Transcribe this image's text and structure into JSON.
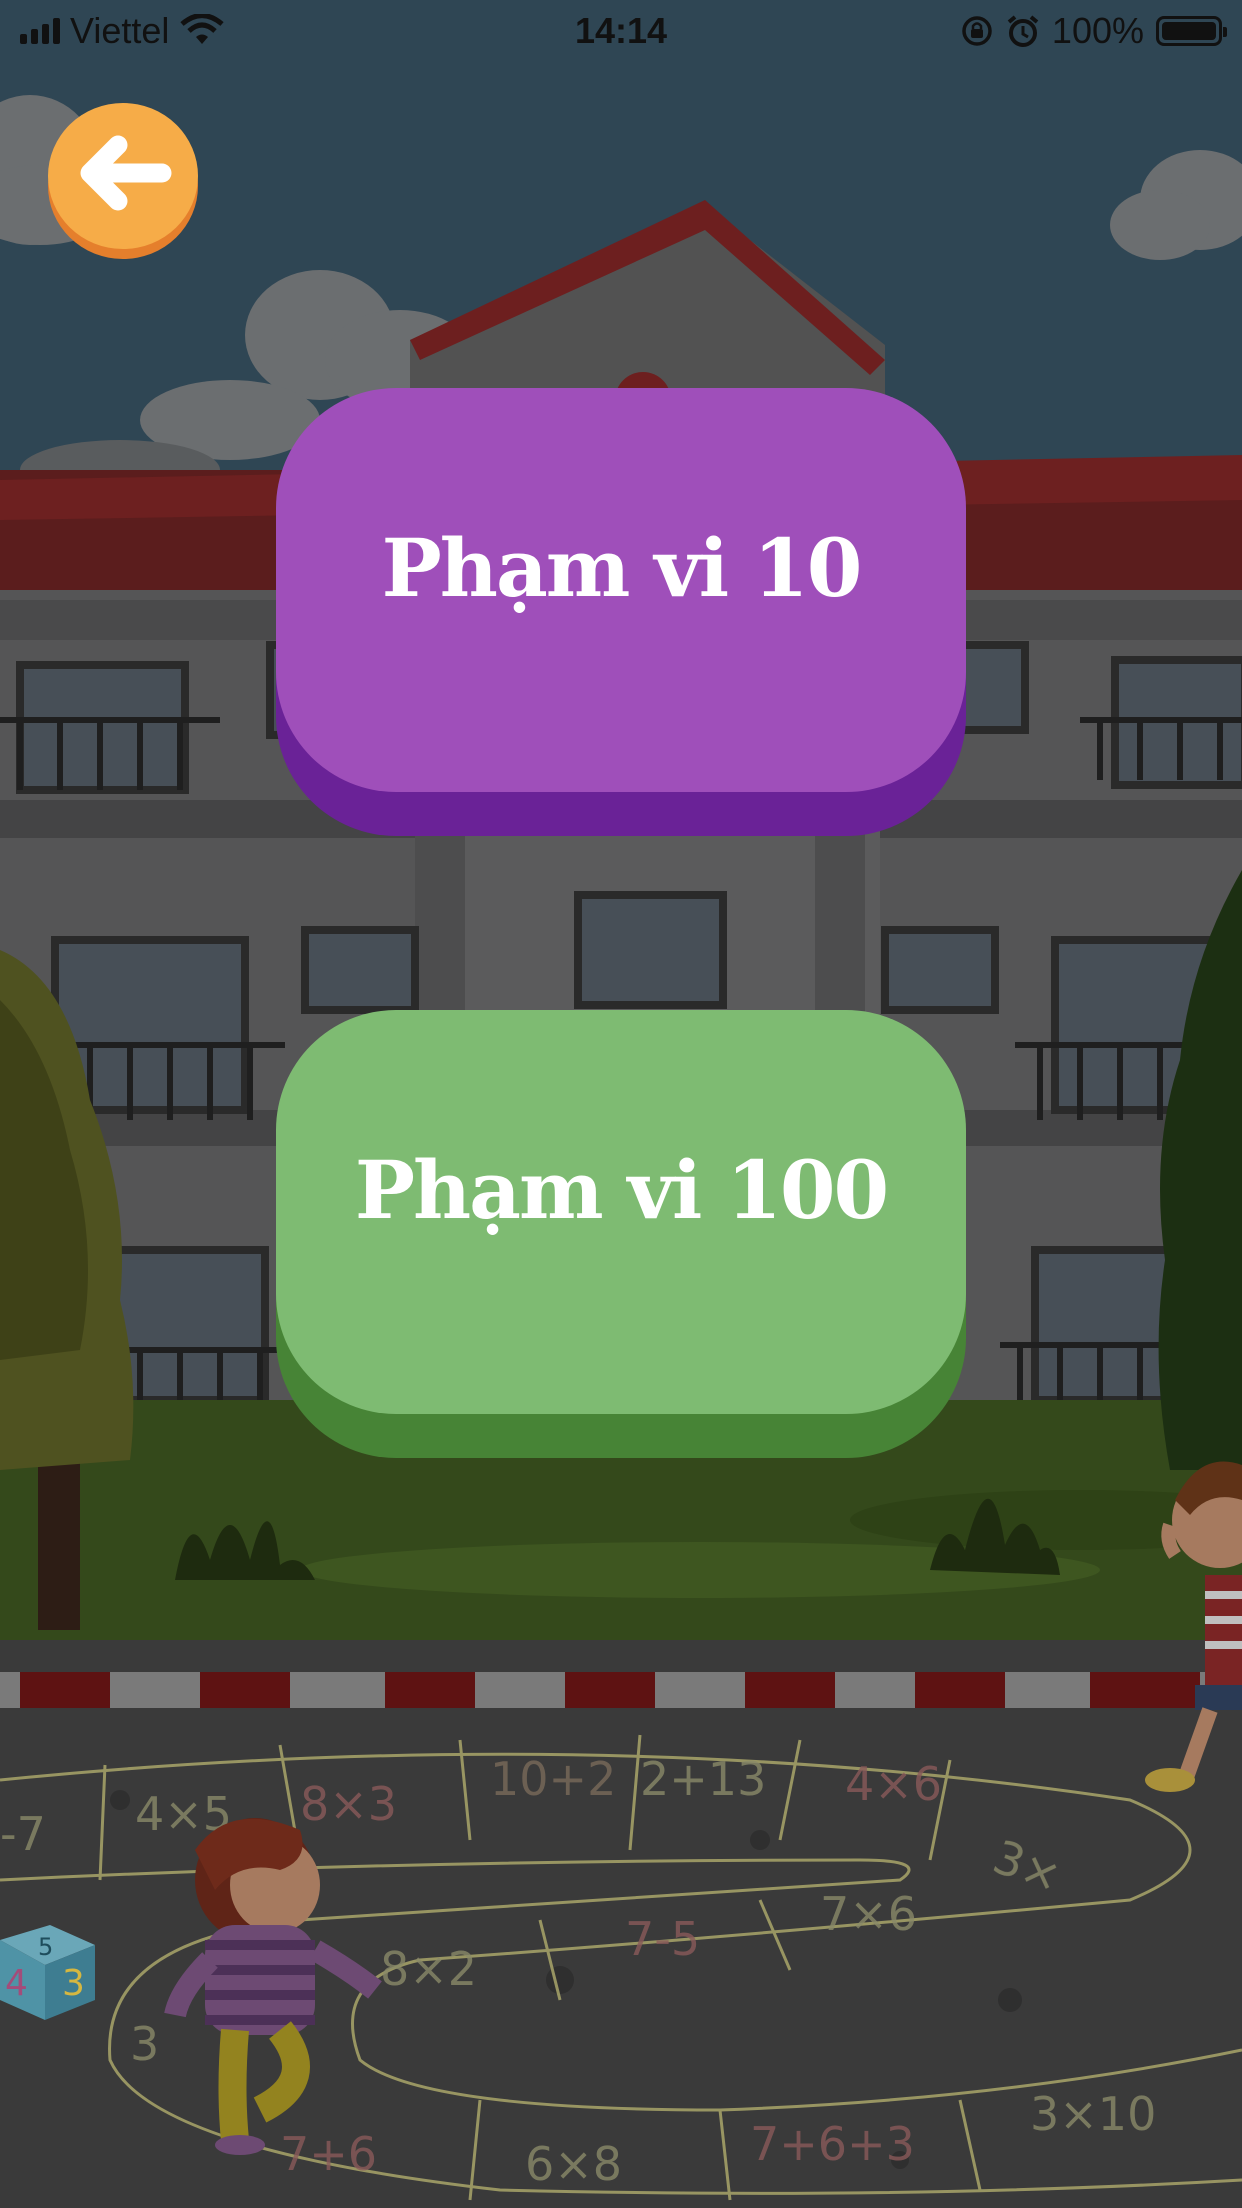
{
  "status_bar": {
    "carrier": "Viettel",
    "time": "14:14",
    "battery": "100%"
  },
  "back_button": {
    "icon": "arrow-left-icon"
  },
  "levels": [
    {
      "label": "Phạm vi 10",
      "color": "#9f4fba",
      "shade": "#6a2297"
    },
    {
      "label": "Phạm vi 100",
      "color": "#7ebb72",
      "shade": "#478436"
    }
  ],
  "hopscotch": {
    "cells": [
      "-7",
      "4×5",
      "8×3",
      "10+2",
      "2+13",
      "4×6",
      "3×",
      "8×2",
      "7-5",
      "7×6",
      "3",
      "7+6",
      "6×8",
      "7+6+3",
      "3×10"
    ],
    "cube_digits": [
      "5",
      "4",
      "3"
    ]
  }
}
